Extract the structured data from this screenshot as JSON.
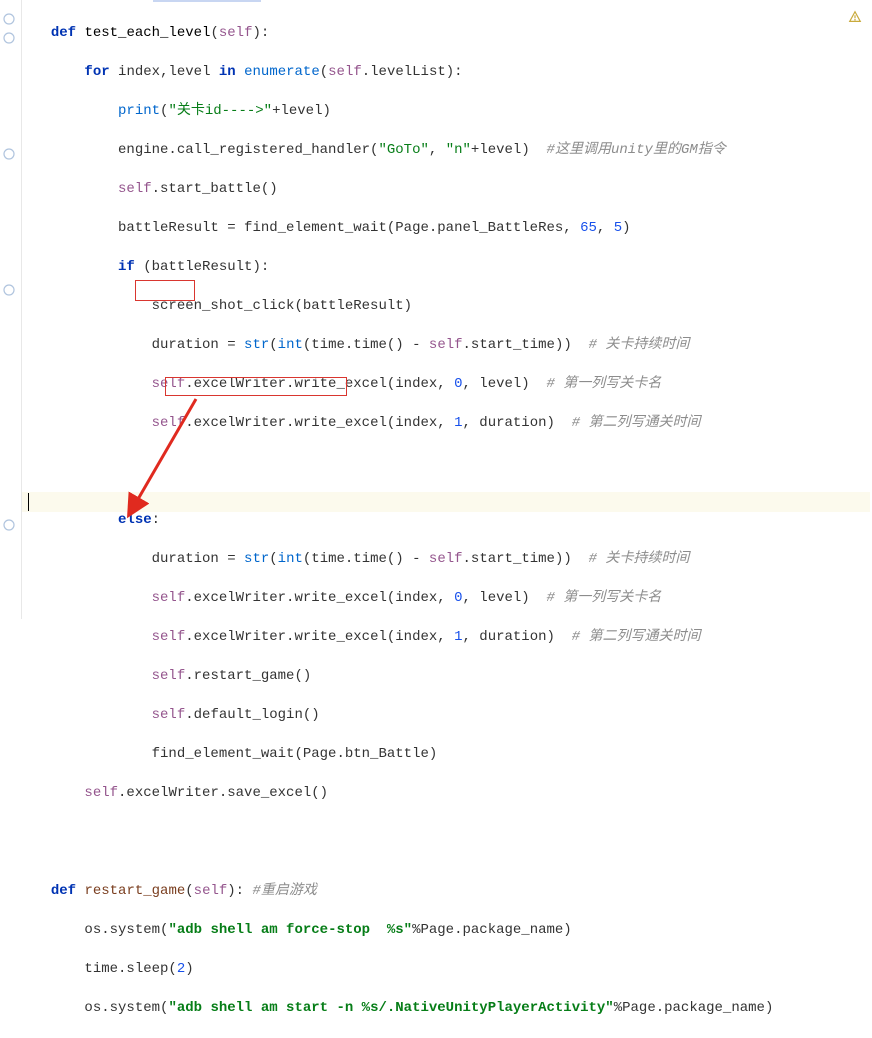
{
  "code": {
    "l1": {
      "kw_def": "def",
      "name": "test_each_level",
      "p_open": "(",
      "self": "self",
      "p_close": "):"
    },
    "l2": {
      "kw_for": "for",
      "idx": "index",
      "comma": ",",
      "lvl": "level",
      "kw_in": "in",
      "enum": "enumerate",
      "p_open": "(",
      "self": "self",
      "attr": ".levelList):"
    },
    "l3": {
      "print": "print",
      "p_open": "(",
      "str": "\"关卡id---->\"",
      "plus": "+",
      "lvl": "level)"
    },
    "l4": {
      "engine": "engine.call_registered_handler(",
      "str1": "\"GoTo\"",
      "comma": ", ",
      "str2": "\"n\"",
      "plus": "+level)  ",
      "comment": "#这里调用unity里的GM指令"
    },
    "l5": {
      "self": "self",
      "call": ".start_battle()"
    },
    "l6": {
      "var": "battleResult = find_element_wait(Page.panel_BattleRes, ",
      "n1": "65",
      "c": ", ",
      "n2": "5",
      "end": ")"
    },
    "l7": {
      "kw_if": "if",
      "sp": " (battleResult):"
    },
    "l8": {
      "call": "screen_shot_click(battleResult)"
    },
    "l9": {
      "var": "duration = ",
      "str_fn": "str",
      "p": "(",
      "int_fn": "int",
      "p2": "(time.time() - ",
      "self": "self",
      "attr": ".start_time))  ",
      "comment": "# 关卡持续时间"
    },
    "l10": {
      "self": "self",
      "call": ".excelWriter.write_excel(index, ",
      "n": "0",
      "rest": ", level)  ",
      "comment": "# 第一列写关卡名"
    },
    "l11": {
      "self": "self",
      "call": ".excelWriter.write_excel(index, ",
      "n": "1",
      "rest": ", duration)  ",
      "comment": "# 第二列写通关时间"
    },
    "l12": {
      "kw_else": "else",
      "colon": ":"
    },
    "l13": {
      "var": "duration = ",
      "str_fn": "str",
      "p": "(",
      "int_fn": "int",
      "p2": "(time.time() - ",
      "self": "self",
      "attr": ".start_time))  ",
      "comment": "# 关卡持续时间"
    },
    "l14": {
      "self": "self",
      "call": ".excelWriter.write_excel(index, ",
      "n": "0",
      "rest": ", level)  ",
      "comment": "# 第一列写关卡名"
    },
    "l15": {
      "self": "self",
      "call": ".excelWriter.write_excel(index, ",
      "n": "1",
      "rest": ", duration)  ",
      "comment": "# 第二列写通关时间"
    },
    "l16": {
      "self": "self",
      "call": ".restart_game()"
    },
    "l17": {
      "self": "self",
      "call": ".default_login()"
    },
    "l18": {
      "call": "find_element_wait(Page.btn_Battle)"
    },
    "l19": {
      "self": "self",
      "call": ".excelWriter.save_excel()"
    },
    "l20": {
      "kw_def": "def",
      "name": "restart_game",
      "p_open": "(",
      "self": "self",
      "p_close": "): ",
      "comment": "#重启游戏"
    },
    "l21": {
      "os": "os.system(",
      "str": "\"adb shell am force-stop  %s\"",
      "rest": "%Page.package_name)"
    },
    "l22": {
      "time": "time.sleep(",
      "n": "2",
      "end": ")"
    },
    "l23": {
      "os": "os.system(",
      "str": "\"adb shell am start -n %s/.NativeUnityPlayerActivity\"",
      "rest": "%Page.package_name)"
    }
  },
  "annotations": {
    "box_else": "else-highlight",
    "box_restart": "restart-game-call-highlight",
    "arrow": "red-arrow"
  }
}
